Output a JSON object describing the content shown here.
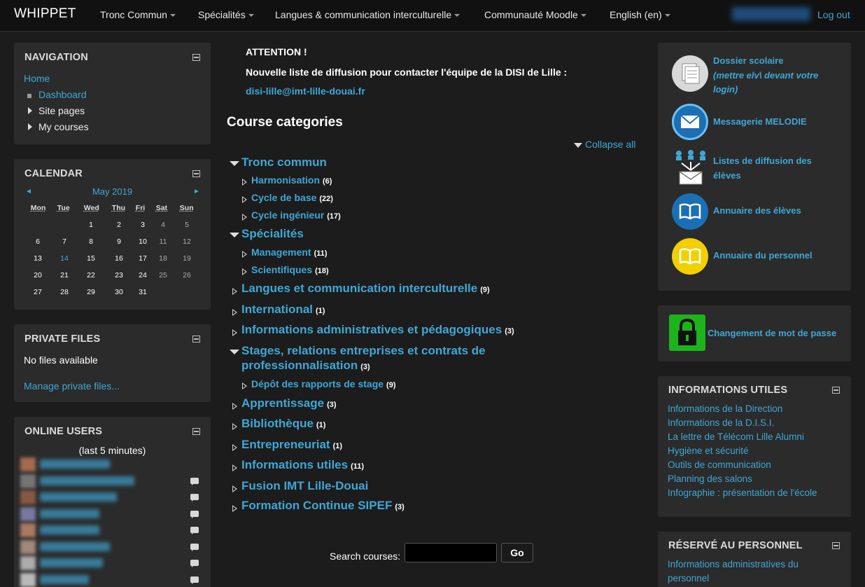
{
  "navbar": {
    "brand": "WHIPPET",
    "menus": [
      "Tronc Commun",
      "Spécialités",
      "Langues & communication interculturelle",
      "Communauté Moodle",
      "English (en)"
    ],
    "logout": "Log out"
  },
  "navigation": {
    "title": "NAVIGATION",
    "home": "Home",
    "items": [
      "Dashboard",
      "Site pages",
      "My courses"
    ]
  },
  "calendar": {
    "title": "CALENDAR",
    "prev": "◄",
    "next": "►",
    "month": "May 2019",
    "days": [
      "Mon",
      "Tue",
      "Wed",
      "Thu",
      "Fri",
      "Sat",
      "Sun"
    ],
    "weeks": [
      [
        "",
        "",
        "1",
        "2",
        "3",
        "4",
        "5"
      ],
      [
        "6",
        "7",
        "8",
        "9",
        "10",
        "11",
        "12"
      ],
      [
        "13",
        "14",
        "15",
        "16",
        "17",
        "18",
        "19"
      ],
      [
        "20",
        "21",
        "22",
        "23",
        "24",
        "25",
        "26"
      ],
      [
        "27",
        "28",
        "29",
        "30",
        "31",
        "",
        ""
      ]
    ],
    "today": "14"
  },
  "private_files": {
    "title": "PRIVATE FILES",
    "empty": "No files available",
    "manage": "Manage private files..."
  },
  "online_users": {
    "title": "ONLINE USERS",
    "subtitle": "(last 5 minutes)"
  },
  "notice": {
    "line1": "ATTENTION !",
    "line2": "Nouvelle liste de diffusion pour contacter l'équipe de la DISI de Lille :",
    "email": "disi-lille@imt-lille-douai.fr"
  },
  "course_categories": {
    "heading": "Course categories",
    "collapse_all": "Collapse all",
    "search_label": "Search courses:",
    "go": "Go",
    "items": [
      {
        "name": "Tronc commun",
        "count": ""
      },
      {
        "name": "Harmonisation",
        "count": "(6)"
      },
      {
        "name": "Cycle de base",
        "count": "(22)"
      },
      {
        "name": "Cycle ingénieur",
        "count": "(17)"
      },
      {
        "name": "Spécialités",
        "count": ""
      },
      {
        "name": "Management",
        "count": "(11)"
      },
      {
        "name": "Scientifiques",
        "count": "(18)"
      },
      {
        "name": "Langues et communication interculturelle",
        "count": "(9)"
      },
      {
        "name": "International",
        "count": "(1)"
      },
      {
        "name": "Informations administratives et pédagogiques",
        "count": "(3)"
      },
      {
        "name": "Stages, relations entreprises et contrats de",
        "count": ""
      },
      {
        "name": "professionnalisation",
        "count": "(3)"
      },
      {
        "name": "Dépôt des rapports de stage",
        "count": "(9)"
      },
      {
        "name": "Apprentissage",
        "count": "(3)"
      },
      {
        "name": "Bibliothèque",
        "count": "(1)"
      },
      {
        "name": "Entrepreneuriat",
        "count": "(1)"
      },
      {
        "name": "Informations utiles",
        "count": "(11)"
      },
      {
        "name": "Fusion IMT Lille-Douai",
        "count": ""
      },
      {
        "name": "Formation Continue SIPEF",
        "count": "(3)"
      }
    ]
  },
  "quick_links": {
    "dossier": "Dossier scolaire",
    "dossier_note_1": "(mettre elv\\ devant votre",
    "dossier_note_2": "login)",
    "messagerie": "Messagerie MELODIE",
    "listes_1": "Listes de diffusion des",
    "listes_2": "élèves",
    "annuaire_eleves": "Annuaire des élèves",
    "annuaire_perso": "Annuaire du personnel",
    "password": "Changement de mot de passe"
  },
  "informations_utiles": {
    "title": "INFORMATIONS UTILES",
    "links": [
      "Informations de la Direction",
      "Informations de la D.I.S.I.",
      "La lettre de Télécom Lille Alumni",
      "Hygiène et sécurité",
      "Outils de communication",
      "Planning des salons",
      "Infographie : présentation de l'école"
    ]
  },
  "reserve": {
    "title": "RÉSERVÉ AU PERSONNEL",
    "link_1": "Informations administratives du",
    "link_2": "personnel"
  },
  "colors": {
    "accent": "#3fa7d6",
    "background": "#1c1c1c",
    "block": "#2b2b2b"
  }
}
